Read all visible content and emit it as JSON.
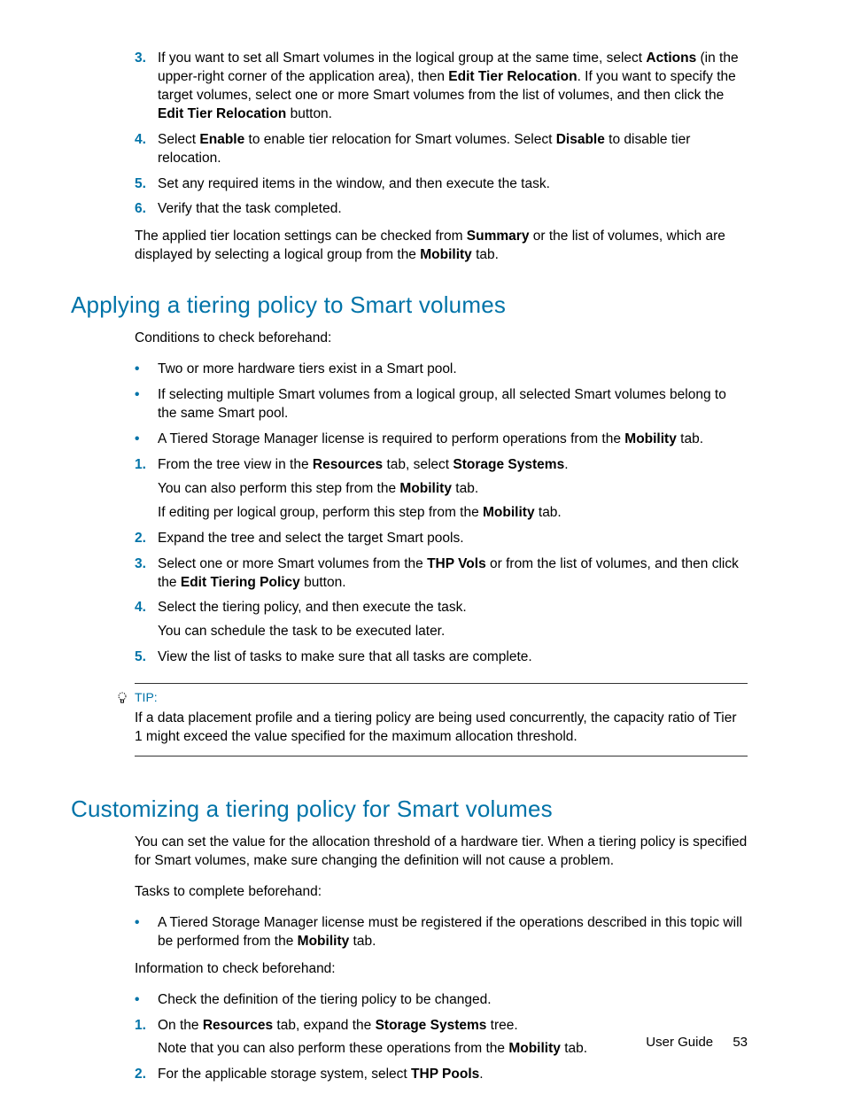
{
  "top": {
    "ol": [
      {
        "n": "3.",
        "segs": [
          {
            "t": "If you want to set all Smart volumes in the logical group at the same time, select "
          },
          {
            "t": "Actions",
            "b": true
          },
          {
            "t": " (in the upper-right corner of the application area), then "
          },
          {
            "t": "Edit Tier Relocation",
            "b": true
          },
          {
            "t": ". If you want to specify the target volumes, select one or more Smart volumes from the list of volumes, and then click the "
          },
          {
            "t": "Edit Tier Relocation",
            "b": true
          },
          {
            "t": " button."
          }
        ]
      },
      {
        "n": "4.",
        "segs": [
          {
            "t": "Select "
          },
          {
            "t": "Enable",
            "b": true
          },
          {
            "t": " to enable tier relocation for Smart volumes. Select "
          },
          {
            "t": "Disable",
            "b": true
          },
          {
            "t": " to disable tier relocation."
          }
        ]
      },
      {
        "n": "5.",
        "segs": [
          {
            "t": "Set any required items in the window, and then execute the task."
          }
        ]
      },
      {
        "n": "6.",
        "segs": [
          {
            "t": "Verify that the task completed."
          }
        ]
      }
    ],
    "para_segs": [
      {
        "t": "The applied tier location settings can be checked from "
      },
      {
        "t": "Summary",
        "b": true
      },
      {
        "t": " or the list of volumes, which are displayed by selecting a logical group from the "
      },
      {
        "t": "Mobility",
        "b": true
      },
      {
        "t": " tab."
      }
    ]
  },
  "sec1": {
    "title": "Applying a tiering policy to Smart volumes",
    "intro": "Conditions to check beforehand:",
    "bullets": [
      [
        {
          "t": "Two or more hardware tiers exist in a Smart pool."
        }
      ],
      [
        {
          "t": "If selecting multiple Smart volumes from a logical group, all selected Smart volumes belong to the same Smart pool."
        }
      ],
      [
        {
          "t": "A Tiered Storage Manager license is required to perform operations from the "
        },
        {
          "t": "Mobility",
          "b": true
        },
        {
          "t": " tab."
        }
      ]
    ],
    "ol": [
      {
        "n": "1.",
        "segs": [
          {
            "t": "From the tree view in the "
          },
          {
            "t": "Resources",
            "b": true
          },
          {
            "t": " tab, select "
          },
          {
            "t": "Storage Systems",
            "b": true
          },
          {
            "t": "."
          }
        ],
        "subs": [
          [
            {
              "t": "You can also perform this step from the "
            },
            {
              "t": "Mobility",
              "b": true
            },
            {
              "t": " tab."
            }
          ],
          [
            {
              "t": "If editing per logical group, perform this step from the "
            },
            {
              "t": "Mobility",
              "b": true
            },
            {
              "t": " tab."
            }
          ]
        ]
      },
      {
        "n": "2.",
        "segs": [
          {
            "t": "Expand the tree and select the target Smart pools."
          }
        ]
      },
      {
        "n": "3.",
        "segs": [
          {
            "t": "Select one or more Smart volumes from the "
          },
          {
            "t": "THP Vols",
            "b": true
          },
          {
            "t": " or from the list of volumes, and then click the "
          },
          {
            "t": "Edit Tiering Policy",
            "b": true
          },
          {
            "t": " button."
          }
        ]
      },
      {
        "n": "4.",
        "segs": [
          {
            "t": "Select the tiering policy, and then execute the task."
          }
        ],
        "subs": [
          [
            {
              "t": "You can schedule the task to be executed later."
            }
          ]
        ]
      },
      {
        "n": "5.",
        "segs": [
          {
            "t": "View the list of tasks to make sure that all tasks are complete."
          }
        ]
      }
    ],
    "tip_label": "TIP:",
    "tip_body": "If a data placement profile and a tiering policy are being used concurrently, the capacity ratio of Tier 1 might exceed the value specified for the maximum allocation threshold."
  },
  "sec2": {
    "title": "Customizing a tiering policy for Smart volumes",
    "intro1": "You can set the value for the allocation threshold of a hardware tier. When a tiering policy is specified for Smart volumes, make sure changing the definition will not cause a problem.",
    "intro2": "Tasks to complete beforehand:",
    "bullets1": [
      [
        {
          "t": "A Tiered Storage Manager license must be registered if the operations described in this topic will be performed from the "
        },
        {
          "t": "Mobility",
          "b": true
        },
        {
          "t": " tab."
        }
      ]
    ],
    "intro3": "Information to check beforehand:",
    "bullets2": [
      [
        {
          "t": "Check the definition of the tiering policy to be changed."
        }
      ]
    ],
    "ol": [
      {
        "n": "1.",
        "segs": [
          {
            "t": "On the "
          },
          {
            "t": "Resources",
            "b": true
          },
          {
            "t": " tab, expand the "
          },
          {
            "t": "Storage Systems",
            "b": true
          },
          {
            "t": " tree."
          }
        ],
        "subs": [
          [
            {
              "t": "Note that you can also perform these operations from the "
            },
            {
              "t": "Mobility",
              "b": true
            },
            {
              "t": " tab."
            }
          ]
        ]
      },
      {
        "n": "2.",
        "segs": [
          {
            "t": "For the applicable storage system, select "
          },
          {
            "t": "THP Pools",
            "b": true
          },
          {
            "t": "."
          }
        ]
      }
    ]
  },
  "footer": {
    "label": "User Guide",
    "page": "53"
  }
}
